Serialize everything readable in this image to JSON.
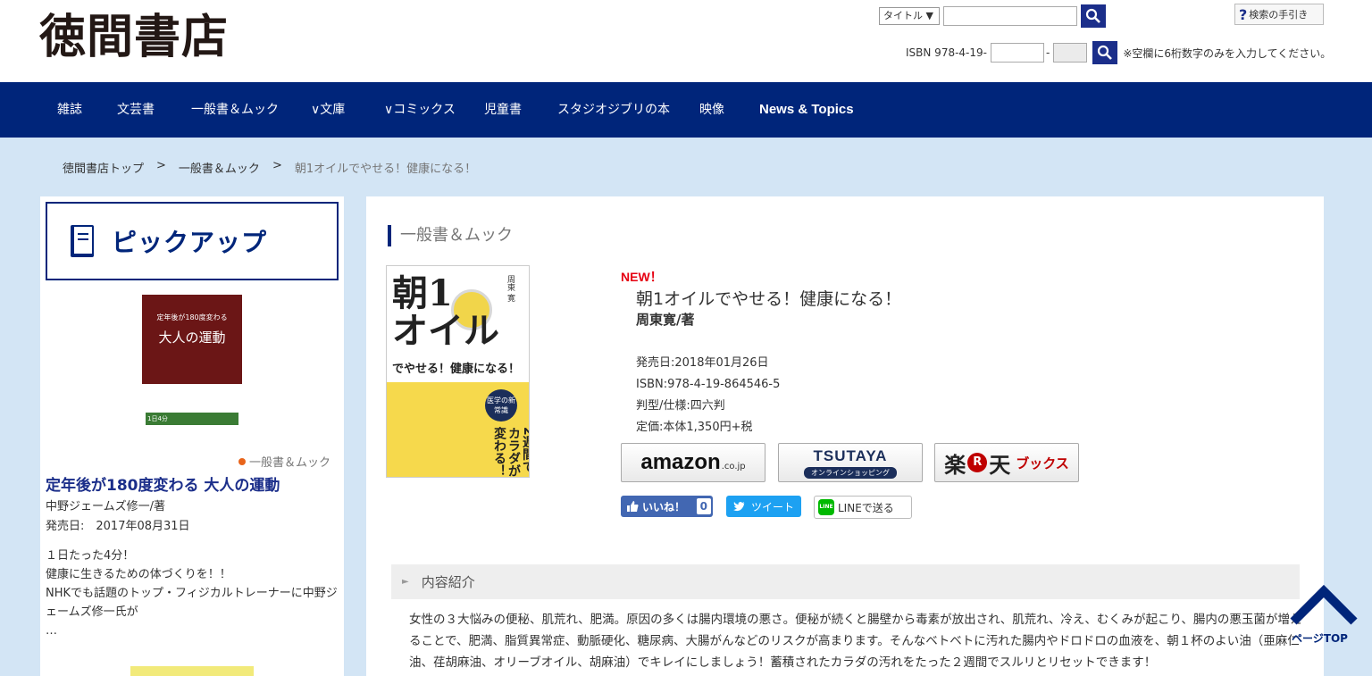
{
  "header": {
    "logo": "徳間書店",
    "search_type": "タイトル ▼",
    "search_value": "",
    "isbn_prefix": "ISBN 978-4-19-",
    "isbn_dash": "-",
    "isbn_note": "※空欄に6桁数字のみを入力してください。",
    "help_label": "検索の手引き"
  },
  "nav": {
    "items": [
      "雑誌",
      "文芸書",
      "一般書＆ムック",
      "∨文庫",
      "∨コミックス",
      "児童書",
      "スタジオジブリの本",
      "映像",
      "News & Topics"
    ]
  },
  "breadcrumb": {
    "home": "徳間書店トップ",
    "sep": ">",
    "category": "一般書＆ムック",
    "current": "朝1オイルでやせる！健康になる！"
  },
  "sidebar": {
    "heading": "ピックアップ",
    "cover_sub": "定年後が180度変わる",
    "cover_title": "大人の運動",
    "cover_band": "1日4分",
    "category": "一般書＆ムック",
    "title": "定年後が180度変わる 大人の運動",
    "author": "中野ジェームズ修一/著",
    "date": "発売日:　2017年08月31日",
    "desc": [
      "１日たった4分！",
      "健康に生きるための体づくりを！！",
      "NHKでも話題のトップ・フィジカルトレーナーに中野ジェームズ修一氏が",
      "…"
    ]
  },
  "main": {
    "category": "一般書＆ムック",
    "cover": {
      "title_line1": "朝1",
      "title_line2": "オイル",
      "subtitle": "でやせる！健康になる！",
      "badge": "医学の新常識",
      "vertical": "2週間でカラダが変わる！",
      "author": "周東 寛"
    },
    "new_label": "NEW！",
    "title": "朝1オイルでやせる！健康になる！",
    "author": "周東寛/著",
    "meta": {
      "date": "発売日:2018年01月26日",
      "isbn": "ISBN:978-4-19-864546-5",
      "format": "判型/仕様:四六判",
      "price": "定価:本体1,350円+税"
    },
    "stores": {
      "amazon": "amazon",
      "amazon_suffix": ".co.jp",
      "tsutaya": "TSUTAYA",
      "tsutaya_sub": "オンラインショッピング",
      "rakuten_1": "楽",
      "rakuten_r": "R",
      "rakuten_2": "天",
      "rakuten_books": "ブックス"
    },
    "social": {
      "like": "いいね！",
      "like_count": "0",
      "tweet": "ツイート",
      "line": "LINEで送る",
      "line_icon": "LINE"
    },
    "intro_heading": "内容紹介",
    "intro_text": "女性の３大悩みの便秘、肌荒れ、肥満。原因の多くは腸内環境の悪さ。便秘が続くと腸壁から毒素が放出され、肌荒れ、冷え、むくみが起こり、腸内の悪玉菌が増えることで、肥満、脂質異常症、動脈硬化、糖尿病、大腸がんなどのリスクが高まります。そんなベトベトに汚れた腸内やドロドロの血液を、朝１杯のよい油（亜麻仁油、荏胡麻油、オリーブオイル、胡麻油）でキレイにしましょう！蓄積されたカラダの汚れをたった２週間でスルリとリセットできます！"
  },
  "pagetop": "ページTOP",
  "colors": {
    "navy": "#00257a",
    "bg": "#d3e5f5",
    "new": "#e60012"
  }
}
